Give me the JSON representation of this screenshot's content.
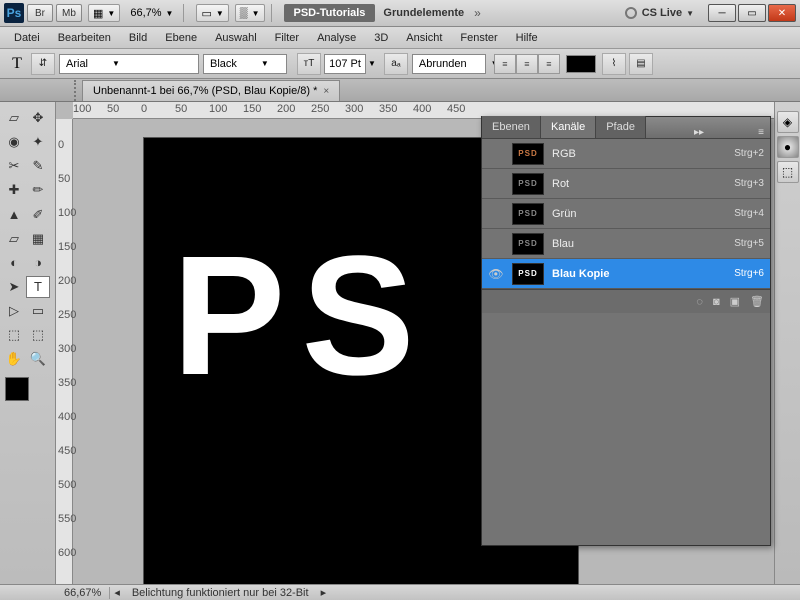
{
  "titlebar": {
    "ps": "Ps",
    "br": "Br",
    "mb": "Mb",
    "zoom": "66,7%",
    "psd_tut": "PSD-Tutorials",
    "grund": "Grundelemente",
    "cslive": "CS Live"
  },
  "menu": [
    "Datei",
    "Bearbeiten",
    "Bild",
    "Ebene",
    "Auswahl",
    "Filter",
    "Analyse",
    "3D",
    "Ansicht",
    "Fenster",
    "Hilfe"
  ],
  "options": {
    "font": "Arial",
    "weight": "Black",
    "size": "107 Pt",
    "aa": "Abrunden"
  },
  "doc": {
    "title": "Unbenannt-1 bei 66,7% (PSD, Blau Kopie/8) *"
  },
  "ruler_h": [
    "100",
    "50",
    "0",
    "50",
    "100",
    "150",
    "200",
    "250",
    "300",
    "350",
    "400",
    "450"
  ],
  "ruler_v": [
    "0",
    "50",
    "100",
    "150",
    "200",
    "250",
    "300",
    "350",
    "400",
    "450",
    "500",
    "550",
    "600"
  ],
  "canvas_text": "PS",
  "panel": {
    "tabs": [
      "Ebenen",
      "Kanäle",
      "Pfade"
    ],
    "channels": [
      {
        "name": "RGB",
        "sc": "Strg+2",
        "thumb": "rgb",
        "eye": false
      },
      {
        "name": "Rot",
        "sc": "Strg+3",
        "thumb": "dim",
        "eye": false
      },
      {
        "name": "Grün",
        "sc": "Strg+4",
        "thumb": "dim",
        "eye": false
      },
      {
        "name": "Blau",
        "sc": "Strg+5",
        "thumb": "dim",
        "eye": false
      },
      {
        "name": "Blau Kopie",
        "sc": "Strg+6",
        "thumb": "white",
        "eye": true,
        "sel": true
      }
    ]
  },
  "status": {
    "zoom": "66,67%",
    "msg": "Belichtung funktioniert nur bei 32-Bit"
  }
}
